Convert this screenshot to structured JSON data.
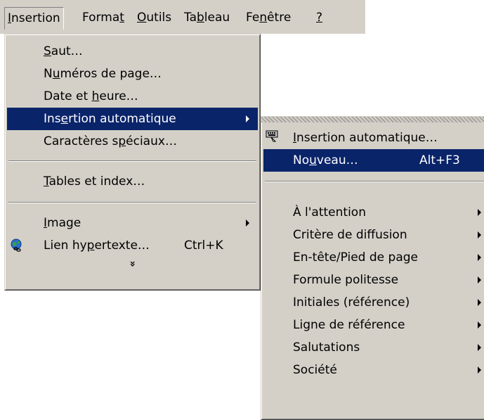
{
  "menubar": {
    "items": [
      {
        "label": "Insertion",
        "accel": "I"
      },
      {
        "label": "Format",
        "accel": "t"
      },
      {
        "label": "Outils",
        "accel": "O"
      },
      {
        "label": "Tableau",
        "accel": "b"
      },
      {
        "label": "Fenêtre",
        "accel": "n"
      },
      {
        "label": "?",
        "accel": "?"
      }
    ]
  },
  "insertion_menu": {
    "items": [
      {
        "pre": "",
        "u": "S",
        "post": "aut…"
      },
      {
        "pre": "N",
        "u": "u",
        "post": "méros de page…"
      },
      {
        "pre": "Date et ",
        "u": "h",
        "post": "eure…"
      },
      {
        "pre": "Ins",
        "u": "e",
        "post": "rtion automatique"
      },
      {
        "pre": "Caractères s",
        "u": "p",
        "post": "éciaux…"
      },
      {
        "pre": "",
        "u": "T",
        "post": "ables et index…"
      },
      {
        "pre": "",
        "u": "I",
        "post": "mage"
      },
      {
        "pre": "Lien hy",
        "u": "p",
        "post": "ertexte…",
        "shortcut": "Ctrl+K"
      }
    ],
    "expand_glyph": "»"
  },
  "autotext_submenu": {
    "items": [
      {
        "pre": "",
        "u": "I",
        "post": "nsertion automatique…"
      },
      {
        "pre": "No",
        "u": "u",
        "post": "veau…",
        "shortcut": "Alt+F3"
      },
      {
        "label": "À l'attention"
      },
      {
        "label": "Critère de diffusion"
      },
      {
        "label": "En-tête/Pied de page"
      },
      {
        "label": "Formule politesse"
      },
      {
        "label": "Initiales (référence)"
      },
      {
        "label": "Ligne de référence"
      },
      {
        "label": "Salutations"
      },
      {
        "label": "Société"
      }
    ]
  },
  "colors": {
    "menu_face": "#d4d0c8",
    "highlight": "#0a246a",
    "highlight_text": "#ffffff"
  }
}
